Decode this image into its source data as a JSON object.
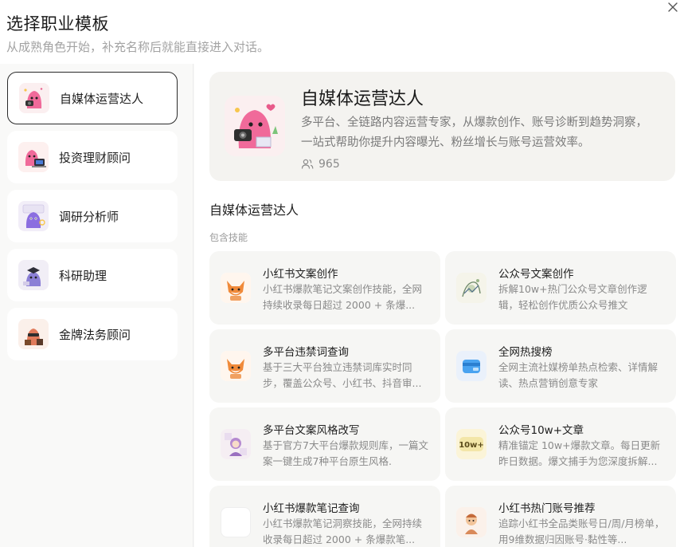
{
  "dialog": {
    "title": "选择职业模板",
    "subtitle": "从成熟角色开始，补充名称后就能直接进入对话。"
  },
  "roles": [
    {
      "label": "自媒体运营达人",
      "icon": "influencer-avatar-icon",
      "active": true
    },
    {
      "label": "投资理财顾问",
      "icon": "investment-advisor-avatar-icon",
      "active": false
    },
    {
      "label": "调研分析师",
      "icon": "research-analyst-avatar-icon",
      "active": false
    },
    {
      "label": "科研助理",
      "icon": "research-assistant-avatar-icon",
      "active": false
    },
    {
      "label": "金牌法务顾问",
      "icon": "legal-advisor-avatar-icon",
      "active": false
    }
  ],
  "detail": {
    "name": "自媒体运营达人",
    "description": "多平台、全链路内容运营专家，从爆款创作、账号诊断到趋势洞察，一站式帮助你提升内容曝光、粉丝增长与账号运营效率。",
    "users_count": "965",
    "section_title": "自媒体运营达人",
    "skills_label": "包含技能"
  },
  "skills": [
    {
      "name": "小红书文案创作",
      "desc": "小红书爆款笔记文案创作技能，全网持续收录每日超过 2000 + 条爆...",
      "icon": "fox-mascot-icon"
    },
    {
      "name": "公众号文案创作",
      "desc": "拆解10w+热门公众号文章创作逻辑，轻松创作优质公众号推文",
      "icon": "sketch-illustration-icon"
    },
    {
      "name": "多平台违禁词查询",
      "desc": "基于三大平台独立违禁词库实时同步，覆盖公众号、小红书、抖音审...",
      "icon": "fox-mascot-icon"
    },
    {
      "name": "全网热搜榜",
      "desc": "全网主流社媒榜单热点检索、详情解读、热点营销创意专家",
      "icon": "wallet-card-icon"
    },
    {
      "name": "多平台文案风格改写",
      "desc": "基于官方7大平台爆款规则库，一篇文案一键生成7种平台原生风格.",
      "icon": "cartoon-girl-icon"
    },
    {
      "name": "公众号10w+文章",
      "desc": "精准锚定 10w+爆款文章。每日更新昨日数据。爆文捕手为您深度拆解...",
      "icon": "badge-10w-icon"
    },
    {
      "name": "小红书爆款笔记查询",
      "desc": "小红书爆款笔记洞察技能，全网持续收录每日超过 2000 + 条爆款笔...",
      "icon": "blank-icon"
    },
    {
      "name": "小红书热门账号推荐",
      "desc": "追踪小红书全品类账号日/周/月榜单，用9维数据归因账号·黏性等...",
      "icon": "cartoon-character-icon"
    }
  ],
  "badge_10w_text": "10w+",
  "colors": {
    "accent": "#2a2a2a",
    "pink": "#f06a9a",
    "card_bg": "#f6f6f4",
    "hero_bg": "#f4f3f0"
  }
}
